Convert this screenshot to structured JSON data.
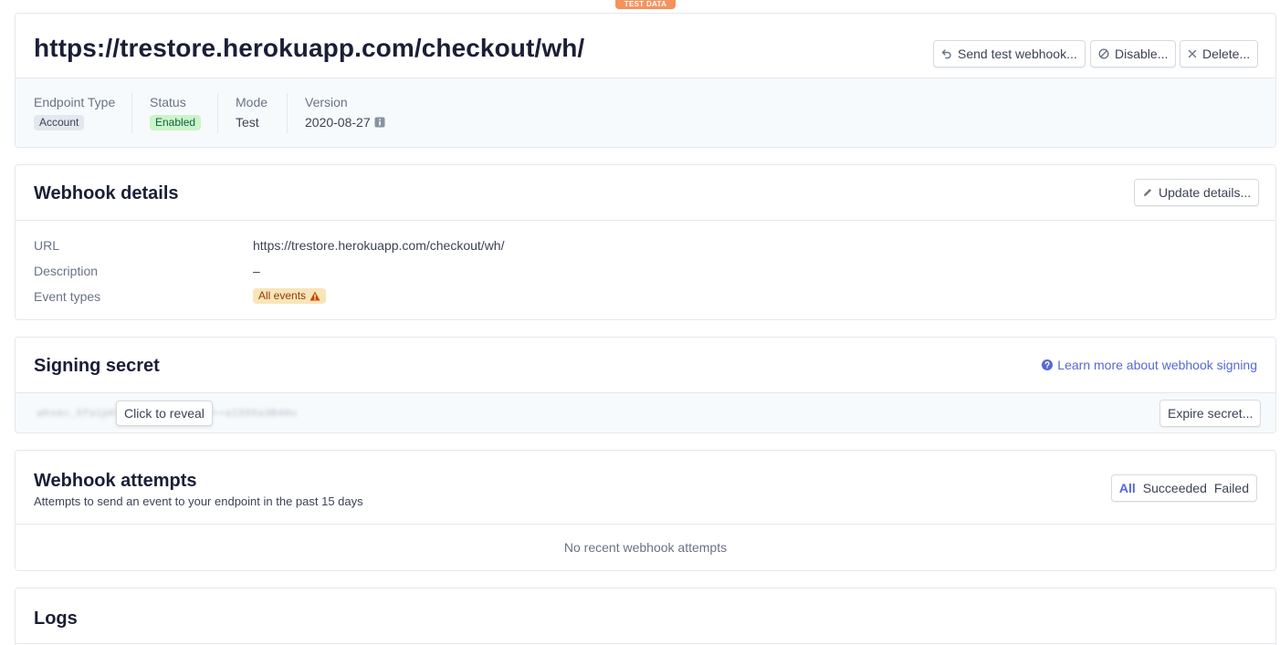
{
  "banner": {
    "label": "TEST DATA"
  },
  "header": {
    "title": "https://trestore.herokuapp.com/checkout/wh/",
    "buttons": {
      "send_test": "Send test webhook...",
      "disable": "Disable...",
      "delete": "Delete..."
    },
    "meta": [
      {
        "label": "Endpoint Type",
        "value": "Account"
      },
      {
        "label": "Status",
        "value": "Enabled"
      },
      {
        "label": "Mode",
        "value": "Test"
      },
      {
        "label": "Version",
        "value": "2020-08-27"
      }
    ]
  },
  "details": {
    "title": "Webhook details",
    "update_label": "Update details...",
    "rows": [
      {
        "label": "URL",
        "value": "https://trestore.herokuapp.com/checkout/wh/"
      },
      {
        "label": "Description",
        "value": "–"
      },
      {
        "label": "Event types",
        "value": "All events"
      }
    ]
  },
  "secret": {
    "title": "Signing secret",
    "learn_link": "Learn more about webhook signing",
    "masked": "whsec_6fa1pH•••••••••••••••••a1S9Xa3B4Hu",
    "reveal_label": "Click to reveal",
    "expire_label": "Expire secret..."
  },
  "attempts": {
    "title": "Webhook attempts",
    "subtitle": "Attempts to send an event to your endpoint in the past 15 days",
    "filters": [
      "All",
      "Succeeded",
      "Failed"
    ],
    "active_filter": "All",
    "empty_text": "No recent webhook attempts"
  },
  "logs": {
    "title": "Logs"
  },
  "colors": {
    "accent": "#5469d4",
    "banner": "#f5925e",
    "enabled_bg": "#cbf4c9",
    "warning_bg": "#f8e5b9"
  }
}
